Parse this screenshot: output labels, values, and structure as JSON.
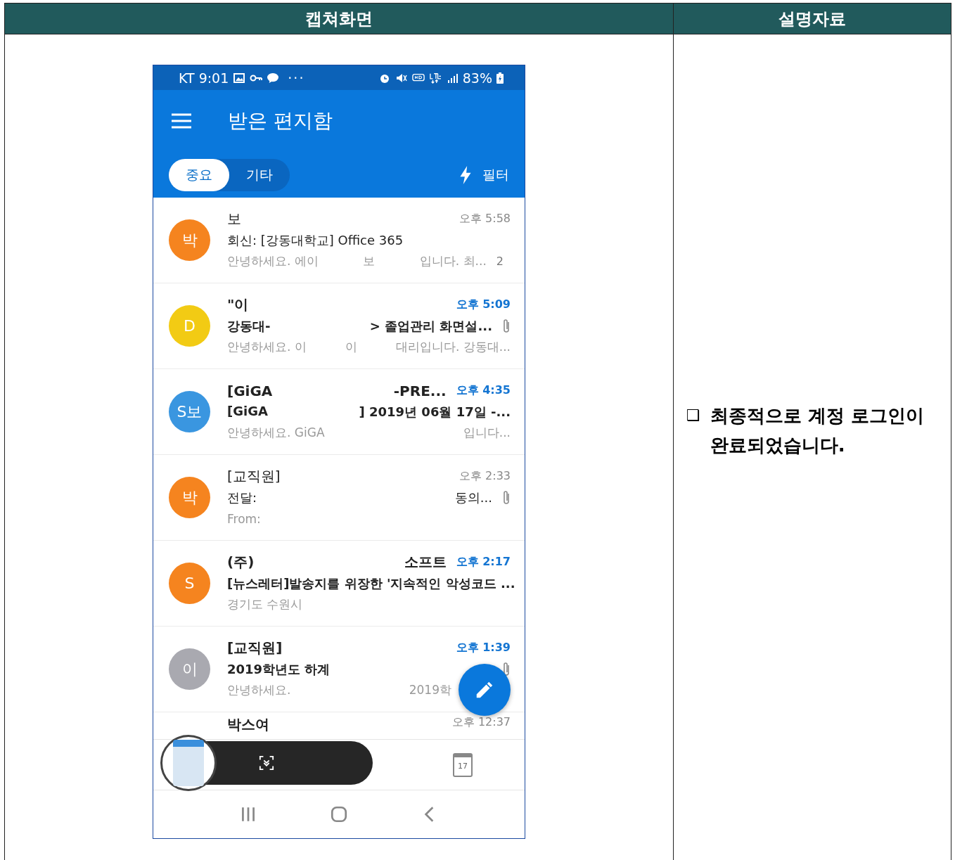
{
  "table": {
    "columns": [
      "캡쳐화면",
      "설명자료"
    ]
  },
  "phone": {
    "status_bar": {
      "carrier_time": "KT 9:01",
      "dots": "···",
      "battery": "83%"
    },
    "app_bar": {
      "title": "받은 편지함"
    },
    "tabs": [
      {
        "label": "중요",
        "selected": true
      },
      {
        "label": "기타",
        "selected": false
      }
    ],
    "filter": {
      "label": "필터"
    },
    "emails": [
      {
        "avatar": "박",
        "color": "#f5841f",
        "unread": false,
        "attachment": false,
        "time": "오후 5:58",
        "sender": [
          "보"
        ],
        "subject": [
          "회신: [강동대학교] Office 365"
        ],
        "preview": [
          "안녕하세요. 에이",
          "보",
          "입니다. 최..."
        ],
        "count": "2"
      },
      {
        "avatar": "D",
        "color": "#f2cb14",
        "unread": true,
        "attachment": true,
        "time": "오후 5:09",
        "sender": [
          "\"이"
        ],
        "subject": [
          "강동대-",
          "> 졸업관리 화면설..."
        ],
        "preview": [
          "안녕하세요. 이",
          "이",
          "대리입니다. 강동대..."
        ]
      },
      {
        "avatar": "S보",
        "color": "#3a96e0",
        "unread": true,
        "attachment": false,
        "time": "오후 4:35",
        "sender": [
          "[GiGA",
          "-PRE..."
        ],
        "subject": [
          "[GiGA",
          "] 2019년 06월 17일 -..."
        ],
        "preview": [
          "안녕하세요. GiGA",
          "입니다..."
        ]
      },
      {
        "avatar": "박",
        "color": "#f5841f",
        "unread": false,
        "attachment": true,
        "time": "오후 2:33",
        "sender": [
          "[교직원]"
        ],
        "subject": [
          "전달:",
          "동의..."
        ],
        "preview": [
          "From:"
        ]
      },
      {
        "avatar": "S",
        "color": "#f5841f",
        "unread": true,
        "attachment": false,
        "time": "오후 2:17",
        "sender": [
          "(주)",
          "소프트"
        ],
        "subject": [
          "[뉴스레터]발송지를 위장한 '지속적인 악성코드 ..."
        ],
        "preview": [
          "경기도 수원시"
        ]
      },
      {
        "avatar": "이",
        "color": "#a9a9b0",
        "unread": true,
        "attachment": true,
        "time": "오후 1:39",
        "sender": [
          "[교직원]"
        ],
        "subject": [
          "2019학년도 하계"
        ],
        "preview": [
          "안녕하세요.",
          "2019학"
        ]
      }
    ],
    "partial_email": {
      "sender": "박스여",
      "time": "오후 12:37"
    },
    "calendar_day": "17"
  },
  "description": {
    "bullet": "❑",
    "text": "최종적으로 계정 로그인이 완료되었습니다."
  }
}
